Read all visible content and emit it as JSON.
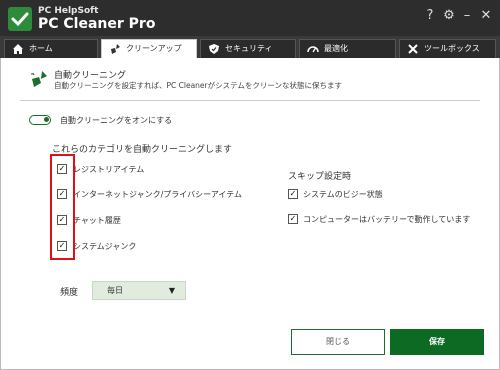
{
  "app": {
    "brand_small": "PC HelpSoft",
    "brand_name": "PC Cleaner Pro",
    "icons": [
      "help-icon",
      "gear-icon",
      "minimize-icon",
      "close-icon"
    ]
  },
  "tabs": [
    {
      "label": "ホーム",
      "icon": "home-icon"
    },
    {
      "label": "クリーンアップ",
      "icon": "broom-icon",
      "active": true
    },
    {
      "label": "セキュリティ",
      "icon": "shield-icon"
    },
    {
      "label": "最適化",
      "icon": "speedometer-icon"
    },
    {
      "label": "ツールボックス",
      "icon": "tools-icon"
    }
  ],
  "header": {
    "title": "自動クリーニング",
    "description": "自動クリーニングを設定すれば、PC Cleanerがシステムをクリーンな状態に保ちます"
  },
  "toggle": {
    "label": "自動クリーニングをオンにする",
    "on": true
  },
  "categories": {
    "title": "これらのカテゴリを自動クリーニングします",
    "items": [
      {
        "label": "レジストリアイテム",
        "checked": true
      },
      {
        "label": "インターネットジャンク/プライバシーアイテム",
        "checked": true
      },
      {
        "label": "チャット履歴",
        "checked": true
      },
      {
        "label": "システムジャンク",
        "checked": true
      }
    ]
  },
  "skip": {
    "title": "スキップ設定時",
    "items": [
      {
        "label": "システムのビジー状態",
        "checked": true
      },
      {
        "label": "コンピューターはバッテリーで動作しています",
        "checked": true
      }
    ]
  },
  "frequency": {
    "label": "頻度",
    "value": "毎日"
  },
  "buttons": {
    "close": "閉じる",
    "save": "保存"
  },
  "colors": {
    "accent": "#0c6a23",
    "titlebar": "#2d2d2d",
    "highlight": "#e0101b"
  }
}
